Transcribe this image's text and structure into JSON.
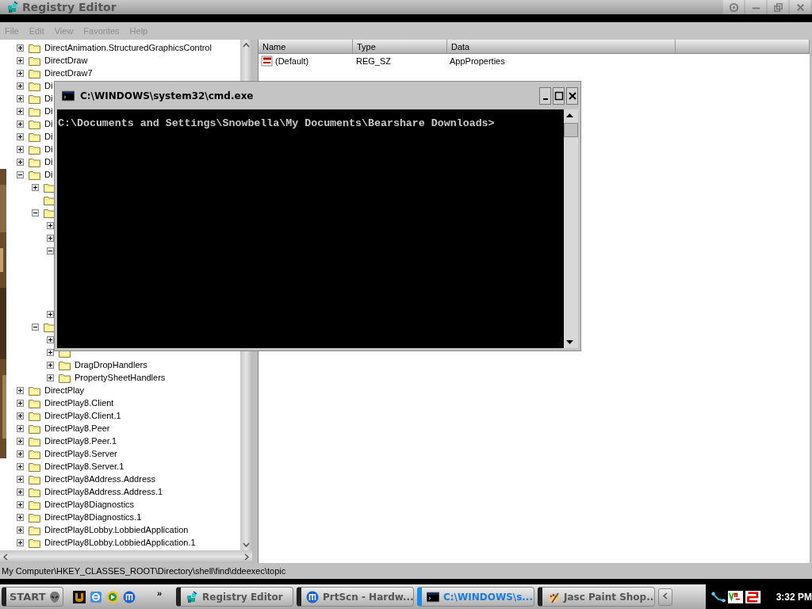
{
  "window": {
    "title": "Registry Editor"
  },
  "menu": [
    {
      "label": "File"
    },
    {
      "label": "Edit"
    },
    {
      "label": "View"
    },
    {
      "label": "Favorites"
    },
    {
      "label": "Help"
    }
  ],
  "tree": {
    "items": [
      {
        "label": "DirectAnimation.StructuredGraphicsControl",
        "kind": "branch",
        "expanded": false
      },
      {
        "label": "DirectDraw",
        "kind": "branch",
        "expanded": false
      },
      {
        "label": "DirectDraw7",
        "kind": "branch",
        "expanded": false
      },
      {
        "label": "Di",
        "kind": "branch",
        "expanded": false
      },
      {
        "label": "Di",
        "kind": "branch",
        "expanded": false
      },
      {
        "label": "Di",
        "kind": "branch",
        "expanded": false
      },
      {
        "label": "Di",
        "kind": "branch",
        "expanded": false
      },
      {
        "label": "Di",
        "kind": "branch",
        "expanded": false
      },
      {
        "label": "Di",
        "kind": "branch",
        "expanded": false
      },
      {
        "label": "Di",
        "kind": "branch",
        "expanded": false
      },
      {
        "label": "Di",
        "kind": "branch",
        "expanded": true,
        "children": [
          {
            "kind": "branch",
            "expanded": false
          },
          {
            "kind": "leaf"
          },
          {
            "kind": "branch",
            "expanded": true,
            "children": [
              {
                "kind": "stub",
                "expanded": false
              },
              {
                "kind": "stub",
                "expanded": false
              },
              {
                "kind": "stub",
                "expanded": true
              },
              {
                "kind": "stub",
                "expanded": false
              }
            ]
          },
          {
            "kind": "branch",
            "expanded": true,
            "children": [
              {
                "kind": "branch",
                "expanded": false
              },
              {
                "kind": "branch",
                "expanded": false
              },
              {
                "label": "DragDropHandlers",
                "kind": "branch",
                "expanded": false
              },
              {
                "label": "PropertySheetHandlers",
                "kind": "branch",
                "expanded": false
              }
            ]
          }
        ]
      },
      {
        "label": "DirectPlay",
        "kind": "branch",
        "expanded": false
      },
      {
        "label": "DirectPlay8.Client",
        "kind": "branch",
        "expanded": false
      },
      {
        "label": "DirectPlay8.Client.1",
        "kind": "branch",
        "expanded": false
      },
      {
        "label": "DirectPlay8.Peer",
        "kind": "branch",
        "expanded": false
      },
      {
        "label": "DirectPlay8.Peer.1",
        "kind": "branch",
        "expanded": false
      },
      {
        "label": "DirectPlay8.Server",
        "kind": "branch",
        "expanded": false
      },
      {
        "label": "DirectPlay8.Server.1",
        "kind": "branch",
        "expanded": false
      },
      {
        "label": "DirectPlay8Address.Address",
        "kind": "branch",
        "expanded": false
      },
      {
        "label": "DirectPlay8Address.Address.1",
        "kind": "branch",
        "expanded": false
      },
      {
        "label": "DirectPlay8Diagnostics",
        "kind": "branch",
        "expanded": false
      },
      {
        "label": "DirectPlay8Diagnostics.1",
        "kind": "branch",
        "expanded": false
      },
      {
        "label": "DirectPlay8Lobby.LobbiedApplication",
        "kind": "branch",
        "expanded": false
      },
      {
        "label": "DirectPlay8Lobby.LobbiedApplication.1",
        "kind": "branch",
        "expanded": false
      }
    ]
  },
  "values": {
    "columns": [
      "Name",
      "Type",
      "Data"
    ],
    "rows": [
      {
        "name": "(Default)",
        "type": "REG_SZ",
        "data": "AppProperties"
      }
    ]
  },
  "status_bar": "My Computer\\HKEY_CLASSES_ROOT\\Directory\\shell\\find\\ddeexec\\topic",
  "console": {
    "title": "C:\\WINDOWS\\system32\\cmd.exe",
    "lines": [
      "C:\\Documents and Settings\\Snowbella\\My Documents\\Bearshare Downloads>"
    ]
  },
  "taskbar": {
    "start": "START",
    "more": "»",
    "quick_launch": [
      {
        "kind": "game"
      },
      {
        "kind": "browser"
      },
      {
        "kind": "player"
      },
      {
        "kind": "maxthon"
      }
    ],
    "tasks": [
      {
        "label": "Registry Editor",
        "kind": "registry",
        "selected": false
      },
      {
        "label": "PrtScn - Hardw...",
        "kind": "maxthon",
        "selected": false
      },
      {
        "label": "C:\\WINDOWS\\s...",
        "kind": "console",
        "selected": true
      },
      {
        "label": "Jasc Paint Shop...",
        "kind": "paint",
        "selected": false
      }
    ],
    "clock": "3:32 PM"
  }
}
